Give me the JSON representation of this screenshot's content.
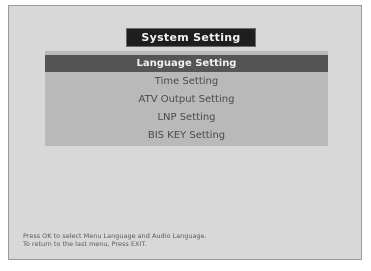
{
  "menu": {
    "title": "System Setting",
    "items": [
      {
        "label": "Language Setting",
        "selected": true
      },
      {
        "label": "Time Setting",
        "selected": false
      },
      {
        "label": "ATV Output Setting",
        "selected": false
      },
      {
        "label": "LNP Setting",
        "selected": false
      },
      {
        "label": "BIS KEY Setting",
        "selected": false
      }
    ]
  },
  "help": {
    "line1": "Press OK to select Menu Language and Audio Language.",
    "line2": "To return to the last menu, Press EXIT."
  },
  "colors": {
    "screen_background": "#d8d8d8",
    "menu_panel": "#b9b9b9",
    "selected_item": "#555555",
    "title_bar": "#1e1e1e"
  }
}
